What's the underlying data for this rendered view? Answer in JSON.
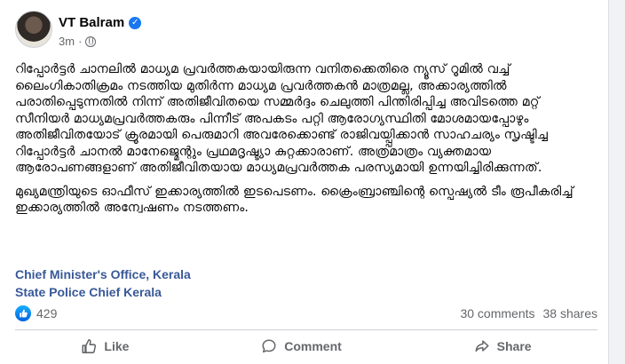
{
  "post": {
    "author": "VT Balram",
    "time": "3m",
    "paragraphs": [
      "റിപ്പോർട്ടർ ചാനലിൽ മാധ്യമ പ്രവർത്തകയായിരുന്ന വനിതക്കെതിരെ ന്യൂസ് റൂമിൽ വച്ച് ലൈംഗികാതിക്രമം നടത്തിയ മുതിർന്ന മാധ്യമ പ്രവർത്തകൻ മാത്രമല്ല, അക്കാര്യത്തിൽ പരാതിപ്പെടുന്നതിൽ നിന്ന് അതിജീവിതയെ സമ്മർദ്ദം ചെലുത്തി പിന്തിരിപ്പിച്ച അവിടത്തെ മറ്റ് സീനിയർ മാധ്യമപ്രവർത്തകരും പിന്നീട് അപകടം പറ്റി ആരോഗ്യസ്ഥിതി മോശമായപ്പോഴും അതിജീവിതയോട് ക്രൂരമായി പെരുമാറി അവരേക്കൊണ്ട് രാജിവയ്പ്പിക്കാൻ സാഹചര്യം സൃഷ്ടിച്ച റിപ്പോർട്ടർ ചാനൽ മാനേജ്മെന്റും പ്രഥമദൃഷ്ട്യാ കുറ്റക്കാരാണ്. അത്രമാത്രം വ്യക്തമായ ആരോപണങ്ങളാണ് അതിജീവിതയായ മാധ്യമപ്രവർത്തക പരസ്യമായി ഉന്നയിച്ചിരിക്കുന്നത്.",
      "മുഖ്യമന്ത്രിയുടെ ഓഫീസ് ഇക്കാര്യത്തിൽ ഇടപെടണം. ക്രൈംബ്രാഞ്ചിന്റെ സ്പെഷ്യൽ ടീം രൂപീകരിച്ച് ഇക്കാര്യത്തിൽ അന്വേഷണം നടത്തണം."
    ],
    "tags": [
      "Chief Minister's Office, Kerala",
      "State Police Chief Kerala"
    ]
  },
  "stats": {
    "reactions": "429",
    "comments": "30 comments",
    "shares": "38 shares"
  },
  "actions": {
    "like": "Like",
    "comment": "Comment",
    "share": "Share"
  },
  "colors": {
    "accent": "#1877f2",
    "link": "#385898",
    "muted": "#65676b"
  }
}
